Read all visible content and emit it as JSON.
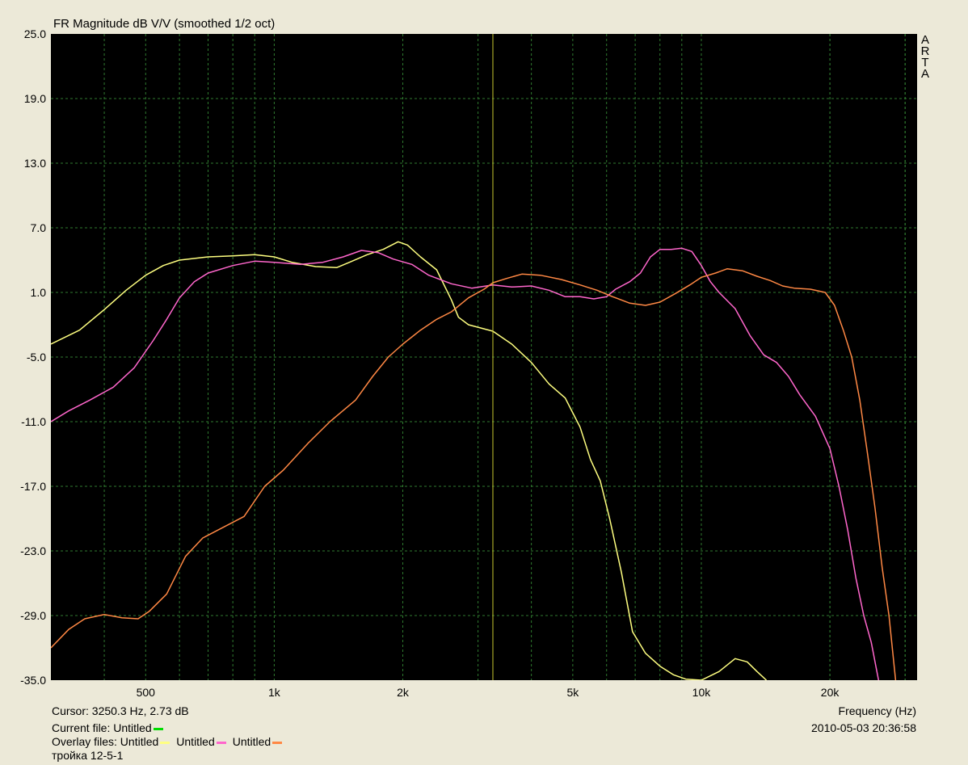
{
  "chart_data": {
    "type": "line",
    "title": "FR Magnitude dB V/V (smoothed 1/2 oct)",
    "xlabel": "Frequency (Hz)",
    "xscale": "log",
    "xlim": [
      300,
      32000
    ],
    "ylim": [
      -35,
      25
    ],
    "y_ticks": [
      "25.0",
      "19.0",
      "13.0",
      "7.0",
      "1.0",
      "-5.0",
      "-11.0",
      "-17.0",
      "-23.0",
      "-29.0",
      "-35.0"
    ],
    "x_ticks": [
      {
        "value": 500,
        "label": "500"
      },
      {
        "value": 1000,
        "label": "1k"
      },
      {
        "value": 2000,
        "label": "2k"
      },
      {
        "value": 5000,
        "label": "5k"
      },
      {
        "value": 10000,
        "label": "10k"
      },
      {
        "value": 20000,
        "label": "20k"
      }
    ],
    "grid": true,
    "cursor": {
      "freq": 3250.3,
      "db": 2.73
    },
    "series": [
      {
        "name": "Untitled",
        "color": "#ffff80",
        "points": [
          [
            300,
            -3.8
          ],
          [
            350,
            -2.5
          ],
          [
            400,
            -0.6
          ],
          [
            450,
            1.2
          ],
          [
            500,
            2.6
          ],
          [
            550,
            3.5
          ],
          [
            600,
            4.0
          ],
          [
            700,
            4.3
          ],
          [
            800,
            4.4
          ],
          [
            900,
            4.5
          ],
          [
            1000,
            4.3
          ],
          [
            1100,
            3.8
          ],
          [
            1250,
            3.4
          ],
          [
            1400,
            3.3
          ],
          [
            1500,
            3.8
          ],
          [
            1650,
            4.5
          ],
          [
            1800,
            5.0
          ],
          [
            1950,
            5.7
          ],
          [
            2050,
            5.4
          ],
          [
            2200,
            4.3
          ],
          [
            2400,
            3.1
          ],
          [
            2600,
            0.3
          ],
          [
            2700,
            -1.3
          ],
          [
            2850,
            -2.0
          ],
          [
            3250,
            -2.6
          ],
          [
            3600,
            -3.8
          ],
          [
            4000,
            -5.5
          ],
          [
            4400,
            -7.5
          ],
          [
            4800,
            -8.8
          ],
          [
            5200,
            -11.5
          ],
          [
            5500,
            -14.5
          ],
          [
            5800,
            -16.5
          ],
          [
            6100,
            -20.0
          ],
          [
            6500,
            -25.0
          ],
          [
            6900,
            -30.5
          ],
          [
            7400,
            -32.5
          ],
          [
            8000,
            -33.7
          ],
          [
            8600,
            -34.5
          ],
          [
            9200,
            -34.9
          ],
          [
            10000,
            -35.0
          ],
          [
            11000,
            -34.2
          ],
          [
            12000,
            -33.0
          ],
          [
            12800,
            -33.3
          ],
          [
            13500,
            -34.2
          ],
          [
            14200,
            -35.0
          ]
        ]
      },
      {
        "name": "Untitled",
        "color": "#ff66cc",
        "points": [
          [
            300,
            -11.0
          ],
          [
            330,
            -10.0
          ],
          [
            370,
            -9.0
          ],
          [
            420,
            -7.8
          ],
          [
            470,
            -6.0
          ],
          [
            520,
            -3.5
          ],
          [
            560,
            -1.5
          ],
          [
            600,
            0.5
          ],
          [
            650,
            2.0
          ],
          [
            700,
            2.8
          ],
          [
            800,
            3.5
          ],
          [
            900,
            3.9
          ],
          [
            1000,
            3.8
          ],
          [
            1150,
            3.6
          ],
          [
            1300,
            3.8
          ],
          [
            1450,
            4.3
          ],
          [
            1600,
            4.9
          ],
          [
            1750,
            4.7
          ],
          [
            1900,
            4.1
          ],
          [
            2100,
            3.6
          ],
          [
            2300,
            2.6
          ],
          [
            2600,
            1.8
          ],
          [
            2900,
            1.4
          ],
          [
            3250,
            1.7
          ],
          [
            3600,
            1.5
          ],
          [
            4000,
            1.6
          ],
          [
            4400,
            1.2
          ],
          [
            4800,
            0.6
          ],
          [
            5200,
            0.6
          ],
          [
            5600,
            0.4
          ],
          [
            6000,
            0.6
          ],
          [
            6300,
            1.3
          ],
          [
            6800,
            2.0
          ],
          [
            7200,
            2.8
          ],
          [
            7600,
            4.3
          ],
          [
            8000,
            5.0
          ],
          [
            8500,
            5.0
          ],
          [
            9000,
            5.1
          ],
          [
            9500,
            4.8
          ],
          [
            10000,
            3.5
          ],
          [
            10500,
            2.0
          ],
          [
            11000,
            1.0
          ],
          [
            12000,
            -0.5
          ],
          [
            13000,
            -3.0
          ],
          [
            14000,
            -4.8
          ],
          [
            15000,
            -5.5
          ],
          [
            16000,
            -6.8
          ],
          [
            17000,
            -8.5
          ],
          [
            18500,
            -10.5
          ],
          [
            20000,
            -13.5
          ],
          [
            21000,
            -17.0
          ],
          [
            22000,
            -21.0
          ],
          [
            23000,
            -25.5
          ],
          [
            24000,
            -29.0
          ],
          [
            25000,
            -31.5
          ],
          [
            26000,
            -35.0
          ]
        ]
      },
      {
        "name": "Untitled",
        "color": "#ff8844",
        "points": [
          [
            300,
            -32.0
          ],
          [
            330,
            -30.3
          ],
          [
            360,
            -29.3
          ],
          [
            400,
            -28.9
          ],
          [
            440,
            -29.2
          ],
          [
            480,
            -29.3
          ],
          [
            510,
            -28.6
          ],
          [
            560,
            -27.0
          ],
          [
            620,
            -23.5
          ],
          [
            680,
            -21.8
          ],
          [
            760,
            -20.8
          ],
          [
            850,
            -19.8
          ],
          [
            950,
            -17.0
          ],
          [
            1050,
            -15.5
          ],
          [
            1200,
            -13.0
          ],
          [
            1350,
            -11.0
          ],
          [
            1550,
            -9.0
          ],
          [
            1700,
            -6.8
          ],
          [
            1850,
            -5.0
          ],
          [
            2000,
            -3.8
          ],
          [
            2200,
            -2.5
          ],
          [
            2400,
            -1.5
          ],
          [
            2600,
            -0.8
          ],
          [
            2850,
            0.5
          ],
          [
            3100,
            1.3
          ],
          [
            3250,
            1.9
          ],
          [
            3500,
            2.3
          ],
          [
            3800,
            2.7
          ],
          [
            4200,
            2.6
          ],
          [
            4700,
            2.2
          ],
          [
            5200,
            1.7
          ],
          [
            5700,
            1.2
          ],
          [
            6200,
            0.6
          ],
          [
            6800,
            0.0
          ],
          [
            7400,
            -0.2
          ],
          [
            8000,
            0.1
          ],
          [
            8700,
            0.9
          ],
          [
            9400,
            1.7
          ],
          [
            10000,
            2.4
          ],
          [
            10800,
            2.8
          ],
          [
            11500,
            3.2
          ],
          [
            12500,
            3.0
          ],
          [
            13500,
            2.5
          ],
          [
            14500,
            2.1
          ],
          [
            15500,
            1.6
          ],
          [
            16500,
            1.4
          ],
          [
            18000,
            1.3
          ],
          [
            19500,
            1.0
          ],
          [
            20500,
            -0.2
          ],
          [
            21500,
            -2.5
          ],
          [
            22500,
            -5.0
          ],
          [
            23500,
            -9.0
          ],
          [
            24500,
            -14.0
          ],
          [
            25500,
            -19.0
          ],
          [
            26500,
            -24.5
          ],
          [
            27500,
            -29.0
          ],
          [
            28500,
            -35.0
          ]
        ]
      }
    ]
  },
  "arta_letters": [
    "A",
    "R",
    "T",
    "A"
  ],
  "info": {
    "cursor_text": "Cursor: 3250.3 Hz, 2.73 dB",
    "current_file_label": "Current file: Untitled",
    "current_file_color": "#00dd00",
    "overlay_label": "Overlay files: Untitled",
    "overlay2": "Untitled",
    "overlay3": "Untitled",
    "note": "тройка 12-5-1",
    "date_text": "2010-05-03  20:36:58"
  },
  "colors": {
    "plot_bg": "#000000",
    "grid": "#2f7a2f",
    "cursor": "#c8c830"
  }
}
